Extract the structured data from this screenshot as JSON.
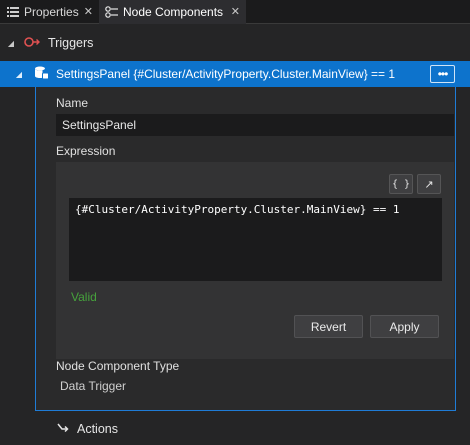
{
  "tabs": [
    {
      "label": "Properties",
      "icon": "list-icon",
      "active": false
    },
    {
      "label": "Node Components",
      "icon": "node-components-icon",
      "active": true
    }
  ],
  "triggers": {
    "label": "Triggers",
    "icon": "trigger-icon",
    "item": {
      "label": "SettingsPanel {#Cluster/ActivityProperty.Cluster.MainView} == 1",
      "icon": "data-trigger-icon",
      "more_label": "•••"
    }
  },
  "panel": {
    "name_label": "Name",
    "name_value": "SettingsPanel",
    "expression_label": "Expression",
    "expression_value": "{#Cluster/ActivityProperty.Cluster.MainView} == 1",
    "braces_label": "{ }",
    "popout_label": "↗",
    "status_text": "Valid",
    "revert_label": "Revert",
    "apply_label": "Apply",
    "type_label": "Node Component Type",
    "type_value": "Data Trigger"
  },
  "actions": {
    "label": "Actions",
    "icon": "action-arrow-icon"
  },
  "colors": {
    "selection": "#0d73cc",
    "valid": "#46a23c",
    "trigger_icon": "#e05252",
    "background": "#252526"
  }
}
